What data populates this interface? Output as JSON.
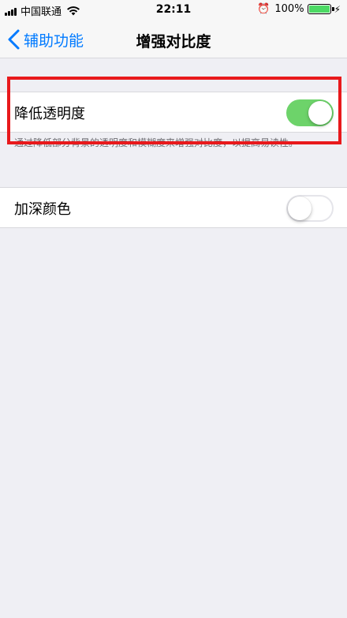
{
  "status_bar": {
    "carrier": "中国联通",
    "time": "22:11",
    "battery": "100%"
  },
  "nav": {
    "back_label": "辅助功能",
    "title": "增强对比度"
  },
  "settings": {
    "reduce_transparency": {
      "label": "降低透明度",
      "enabled": true,
      "footer": "通过降低部分背景的透明度和模糊度来增强对比度，以提高易读性。"
    },
    "darken_colors": {
      "label": "加深颜色",
      "enabled": false
    }
  },
  "colors": {
    "accent": "#007aff",
    "toggle_on": "#6dd36a",
    "highlight": "#e8191c"
  }
}
